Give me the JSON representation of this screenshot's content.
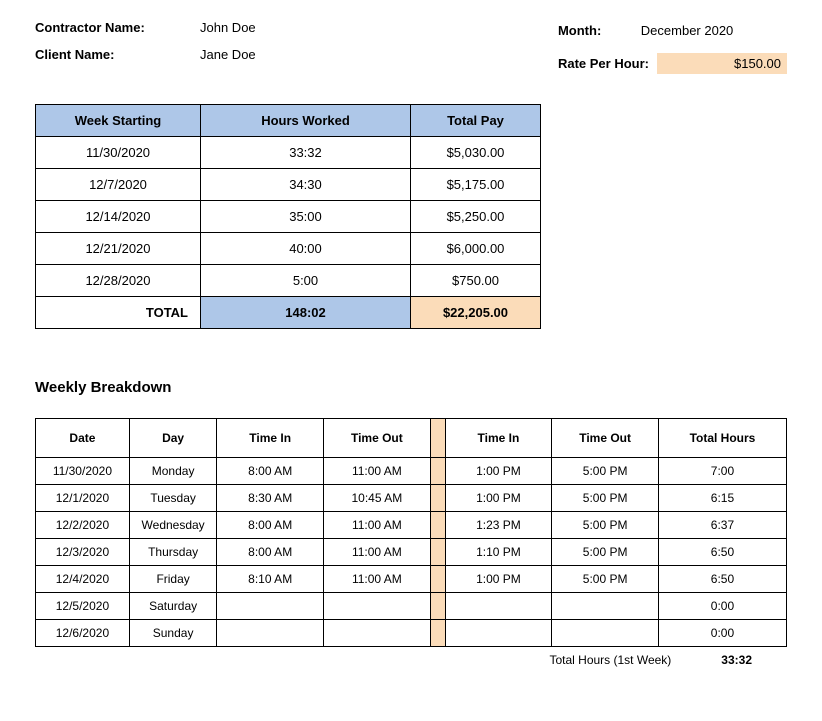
{
  "header": {
    "contractor_label": "Contractor Name:",
    "contractor_value": "John Doe",
    "client_label": "Client Name:",
    "client_value": "Jane Doe",
    "month_label": "Month:",
    "month_value": "December 2020",
    "rate_label": "Rate Per Hour:",
    "rate_value": "$150.00"
  },
  "summary": {
    "headers": {
      "week": "Week Starting",
      "hours": "Hours Worked",
      "pay": "Total Pay"
    },
    "rows": [
      {
        "week": "11/30/2020",
        "hours": "33:32",
        "pay": "$5,030.00"
      },
      {
        "week": "12/7/2020",
        "hours": "34:30",
        "pay": "$5,175.00"
      },
      {
        "week": "12/14/2020",
        "hours": "35:00",
        "pay": "$5,250.00"
      },
      {
        "week": "12/21/2020",
        "hours": "40:00",
        "pay": "$6,000.00"
      },
      {
        "week": "12/28/2020",
        "hours": "5:00",
        "pay": "$750.00"
      }
    ],
    "total": {
      "label": "TOTAL",
      "hours": "148:02",
      "pay": "$22,205.00"
    }
  },
  "breakdown": {
    "title": "Weekly Breakdown",
    "headers": {
      "date": "Date",
      "day": "Day",
      "time_in": "Time In",
      "time_out": "Time Out",
      "time_in2": "Time In",
      "time_out2": "Time Out",
      "total": "Total Hours"
    },
    "rows": [
      {
        "date": "11/30/2020",
        "day": "Monday",
        "in1": "8:00 AM",
        "out1": "11:00 AM",
        "in2": "1:00 PM",
        "out2": "5:00 PM",
        "total": "7:00"
      },
      {
        "date": "12/1/2020",
        "day": "Tuesday",
        "in1": "8:30 AM",
        "out1": "10:45 AM",
        "in2": "1:00 PM",
        "out2": "5:00 PM",
        "total": "6:15"
      },
      {
        "date": "12/2/2020",
        "day": "Wednesday",
        "in1": "8:00 AM",
        "out1": "11:00 AM",
        "in2": "1:23 PM",
        "out2": "5:00 PM",
        "total": "6:37"
      },
      {
        "date": "12/3/2020",
        "day": "Thursday",
        "in1": "8:00 AM",
        "out1": "11:00 AM",
        "in2": "1:10 PM",
        "out2": "5:00 PM",
        "total": "6:50"
      },
      {
        "date": "12/4/2020",
        "day": "Friday",
        "in1": "8:10 AM",
        "out1": "11:00 AM",
        "in2": "1:00 PM",
        "out2": "5:00 PM",
        "total": "6:50"
      },
      {
        "date": "12/5/2020",
        "day": "Saturday",
        "in1": "",
        "out1": "",
        "in2": "",
        "out2": "",
        "total": "0:00"
      },
      {
        "date": "12/6/2020",
        "day": "Sunday",
        "in1": "",
        "out1": "",
        "in2": "",
        "out2": "",
        "total": "0:00"
      }
    ],
    "footer": {
      "label": "Total Hours (1st Week)",
      "value": "33:32"
    }
  }
}
